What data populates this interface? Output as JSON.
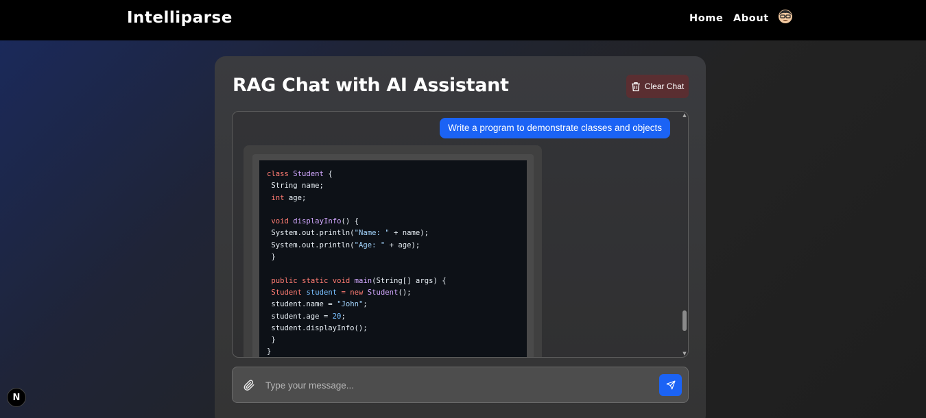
{
  "navbar": {
    "brand": "Intelliparse",
    "links": [
      {
        "label": "Home"
      },
      {
        "label": "About"
      }
    ],
    "avatar_icon": "user-avatar-icon"
  },
  "chat": {
    "title": "RAG Chat with AI Assistant",
    "clear_label": "Clear Chat",
    "clear_icon": "trash-icon",
    "user_message": "Write a program to demonstrate classes and objects",
    "code_lines": [
      "class Student {",
      " String name;",
      " int age;",
      "",
      " void displayInfo() {",
      " System.out.println(\"Name: \" + name);",
      " System.out.println(\"Age: \" + age);",
      " }",
      "",
      " public static void main(String[] args) {",
      " Student student = new Student();",
      " student.name = \"John\";",
      " student.age = 20;",
      " student.displayInfo();",
      " }",
      "}"
    ]
  },
  "input": {
    "placeholder": "Type your message...",
    "attach_icon": "paperclip-icon",
    "send_icon": "send-icon"
  },
  "dev_badge": {
    "label": "N"
  },
  "colors": {
    "accent": "#1b63f5",
    "clear_button_bg": "#5a2e31",
    "navbar_bg": "#000000"
  }
}
